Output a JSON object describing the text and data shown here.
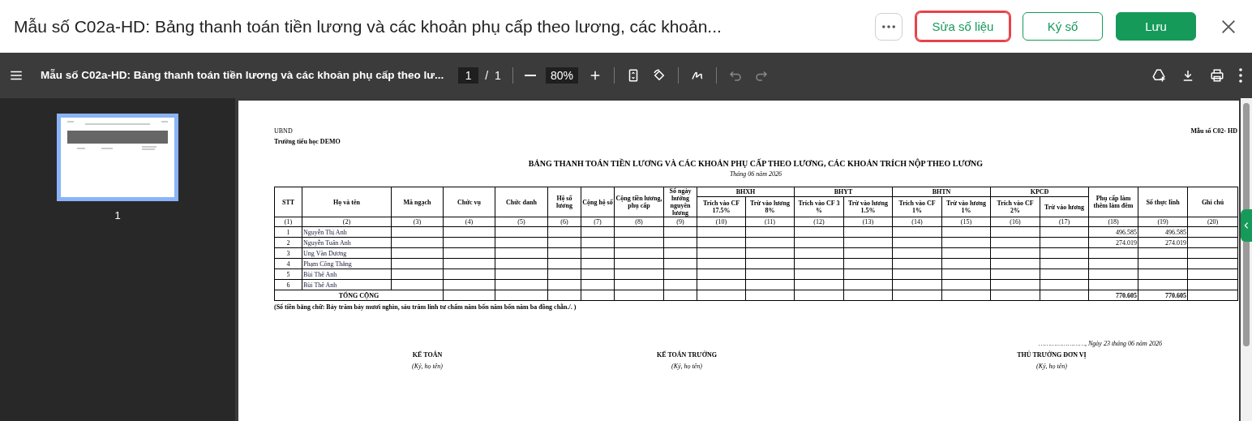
{
  "header": {
    "title": "Mẫu số C02a-HD: Bảng thanh toán tiền lương và các khoản phụ cấp theo lương, các khoản...",
    "buttons": [
      {
        "label": "Sửa số liệu",
        "kind": "outline",
        "highlighted": true
      },
      {
        "label": "Ký số",
        "kind": "outline",
        "highlighted": false
      },
      {
        "label": "Lưu",
        "kind": "primary",
        "highlighted": false
      }
    ]
  },
  "toolbar": {
    "document_title": "Mẫu số C02a-HD: Bảng thanh toán tiền lương và các khoản phụ cấp theo lư...",
    "page_current": "1",
    "page_separator": "/",
    "page_total": "1",
    "zoom": "80%"
  },
  "sidebar": {
    "thumbnails": [
      {
        "label": "1",
        "selected": true
      }
    ]
  },
  "document": {
    "org": "UBND",
    "school": "Trường tiểu học DEMO",
    "form_code": "Mẫu số C02- HD",
    "title": "BẢNG THANH TOÁN TIỀN LƯƠNG VÀ CÁC KHOẢN PHỤ CẤP THEO LƯƠNG, CÁC KHOẢN TRÍCH NỘP THEO LƯƠNG",
    "period": "Tháng 06 năm 2026",
    "columns": [
      {
        "kind": "single",
        "label": "STT",
        "number": "(1)"
      },
      {
        "kind": "single",
        "label": "Họ và tên",
        "number": "(2)"
      },
      {
        "kind": "single",
        "label": "Mã ngạch",
        "number": "(3)"
      },
      {
        "kind": "single",
        "label": "Chức vụ",
        "number": "(4)"
      },
      {
        "kind": "single",
        "label": "Chức danh",
        "number": "(5)"
      },
      {
        "kind": "single",
        "label": "Hệ số lương",
        "number": "(6)"
      },
      {
        "kind": "single",
        "label": "Cộng hệ số",
        "number": "(7)"
      },
      {
        "kind": "single",
        "label": "Cộng tiền lương, phụ cấp",
        "number": "(8)"
      },
      {
        "kind": "single",
        "label": "Số ngày hưởng nguyên lương",
        "number": "(9)"
      },
      {
        "kind": "group",
        "label": "BHXH",
        "subcolumns": [
          {
            "label": "Trích vào CF 17.5%",
            "number": "(10)"
          },
          {
            "label": "Trừ vào lương 8%",
            "number": "(11)"
          }
        ]
      },
      {
        "kind": "group",
        "label": "BHYT",
        "subcolumns": [
          {
            "label": "Trích vào CF 3 %",
            "number": "(12)"
          },
          {
            "label": "Trừ vào lương 1.5%",
            "number": "(13)"
          }
        ]
      },
      {
        "kind": "group",
        "label": "BHTN",
        "subcolumns": [
          {
            "label": "Trích vào CF 1%",
            "number": "(14)"
          },
          {
            "label": "Trừ vào lương 1%",
            "number": "(15)"
          }
        ]
      },
      {
        "kind": "group",
        "label": "KPCĐ",
        "subcolumns": [
          {
            "label": "Trích vào CF 2%",
            "number": "(16)"
          },
          {
            "label": "Trừ vào lương",
            "number": "(17)"
          }
        ]
      },
      {
        "kind": "single",
        "label": "Phụ cấp làm thêm làm đêm",
        "number": "(18)"
      },
      {
        "kind": "single",
        "label": "Số thực lĩnh",
        "number": "(19)"
      },
      {
        "kind": "single",
        "label": "Ghi chú",
        "number": "(20)"
      }
    ],
    "rows": [
      {
        "stt": "1",
        "name": "Nguyễn Thị Anh",
        "overtime_allowance": "496.585",
        "net_pay": "496.585"
      },
      {
        "stt": "2",
        "name": "Nguyễn Tuấn Anh",
        "overtime_allowance": "274.019",
        "net_pay": "274.019"
      },
      {
        "stt": "3",
        "name": "Ung Văn Dương"
      },
      {
        "stt": "4",
        "name": "Phạm Công Thắng"
      },
      {
        "stt": "5",
        "name": "Bùi Thế Anh"
      },
      {
        "stt": "6",
        "name": "Bùi Thế Anh"
      }
    ],
    "total": {
      "label": "TỔNG CỘNG",
      "overtime_allowance": "770.605",
      "net_pay": "770.605"
    },
    "amount_in_words": "(Số tiền bằng chữ: Bảy trăm bảy mươi nghìn, sáu trăm linh tư chấm năm bốn năm bốn năm ba đồng chẵn./. )",
    "date_line": "……………………, Ngày 23 tháng 06 năm 2026",
    "signatures": [
      {
        "title": "KẾ TOÁN",
        "note": "(Ký, họ tên)"
      },
      {
        "title": "KẾ TOÁN TRƯỞNG",
        "note": "(Ký, họ tên)"
      },
      {
        "title": "THỦ TRƯỞNG ĐƠN VỊ",
        "note": "(Ký, họ tên)"
      }
    ]
  }
}
